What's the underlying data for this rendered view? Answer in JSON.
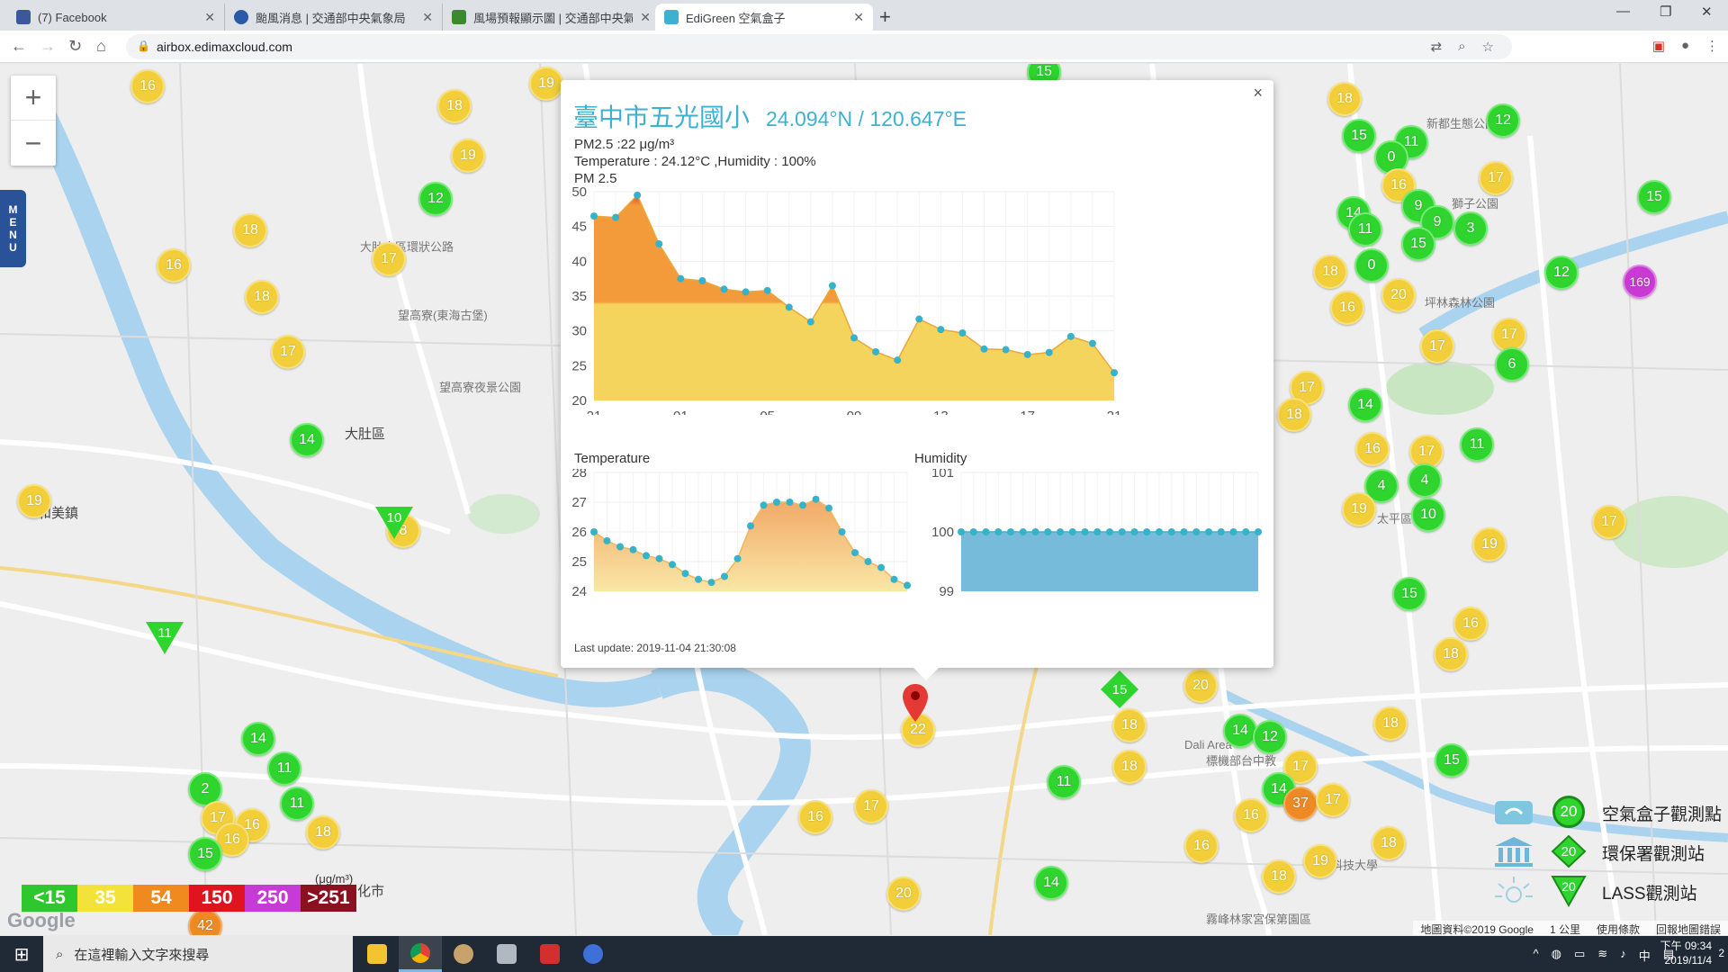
{
  "browser": {
    "tabs": [
      {
        "title": "(7) Facebook",
        "color": "#3b5998"
      },
      {
        "title": "颱風消息 | 交通部中央氣象局",
        "color": "#2a5aa8"
      },
      {
        "title": "風場預報顯示圖 | 交通部中央氣象局",
        "color": "#3c8a2e"
      },
      {
        "title": "EdiGreen 空氣盒子",
        "color": "#3eb1d0"
      }
    ],
    "url": "airbox.edimaxcloud.com"
  },
  "map": {
    "menu_label": "MENU",
    "labels": {
      "dadu": "大肚區",
      "hemei": "和美鎮",
      "wangshan": "望高寮(東海古堡)",
      "wangshan_park": "望高寮夜景公園",
      "dadu_road": "大肚山區環狀公路",
      "xinduk": "新都生態公園",
      "shizi": "獅子公園",
      "pinglin": "坪林森林公園",
      "taiping": "太平區",
      "dali": "Dali Area",
      "dali_zh": "大里區",
      "wufeng": "霧峰林家宮保第園區",
      "changhua": "彰化市",
      "dalisci": "大里科技大學",
      "fit_park": "標機部台中教"
    },
    "markers": [
      {
        "v": "16",
        "c": "y",
        "x": 164,
        "y": 96
      },
      {
        "v": "18",
        "c": "y",
        "x": 505,
        "y": 118
      },
      {
        "v": "19",
        "c": "y",
        "x": 520,
        "y": 173
      },
      {
        "v": "12",
        "c": "g",
        "x": 484,
        "y": 221
      },
      {
        "v": "18",
        "c": "y",
        "x": 278,
        "y": 256
      },
      {
        "v": "16",
        "c": "y",
        "x": 193,
        "y": 295
      },
      {
        "v": "17",
        "c": "y",
        "x": 432,
        "y": 288
      },
      {
        "v": "18",
        "c": "y",
        "x": 291,
        "y": 330
      },
      {
        "v": "17",
        "c": "y",
        "x": 320,
        "y": 391
      },
      {
        "v": "14",
        "c": "g",
        "x": 341,
        "y": 489
      },
      {
        "v": "19",
        "c": "y",
        "x": 38,
        "y": 557
      },
      {
        "v": "19",
        "c": "y",
        "x": 607,
        "y": 93
      },
      {
        "v": "15",
        "c": "g",
        "x": 1160,
        "y": 80
      },
      {
        "v": "18",
        "c": "y",
        "x": 1494,
        "y": 110
      },
      {
        "v": "15",
        "c": "g",
        "x": 1510,
        "y": 151
      },
      {
        "v": "11",
        "c": "g",
        "x": 1568,
        "y": 158
      },
      {
        "v": "0",
        "c": "g",
        "x": 1546,
        "y": 175
      },
      {
        "v": "12",
        "c": "g",
        "x": 1670,
        "y": 134
      },
      {
        "v": "16",
        "c": "y",
        "x": 1554,
        "y": 206
      },
      {
        "v": "17",
        "c": "y",
        "x": 1662,
        "y": 198
      },
      {
        "v": "15",
        "c": "g",
        "x": 1838,
        "y": 219
      },
      {
        "v": "14",
        "c": "g",
        "x": 1504,
        "y": 237
      },
      {
        "v": "11",
        "c": "g",
        "x": 1517,
        "y": 255
      },
      {
        "v": "9",
        "c": "g",
        "x": 1576,
        "y": 229
      },
      {
        "v": "9",
        "c": "g",
        "x": 1597,
        "y": 247
      },
      {
        "v": "15",
        "c": "g",
        "x": 1576,
        "y": 271
      },
      {
        "v": "3",
        "c": "g",
        "x": 1634,
        "y": 254
      },
      {
        "v": "0",
        "c": "g",
        "x": 1524,
        "y": 295
      },
      {
        "v": "18",
        "c": "y",
        "x": 1478,
        "y": 302
      },
      {
        "v": "20",
        "c": "y",
        "x": 1554,
        "y": 328
      },
      {
        "v": "16",
        "c": "y",
        "x": 1497,
        "y": 342
      },
      {
        "v": "12",
        "c": "g",
        "x": 1735,
        "y": 303
      },
      {
        "v": "169",
        "c": "p",
        "x": 1822,
        "y": 313
      },
      {
        "v": "17",
        "c": "y",
        "x": 1677,
        "y": 372
      },
      {
        "v": "6",
        "c": "g",
        "x": 1680,
        "y": 405
      },
      {
        "v": "17",
        "c": "y",
        "x": 1597,
        "y": 385
      },
      {
        "v": "17",
        "c": "y",
        "x": 1452,
        "y": 431
      },
      {
        "v": "18",
        "c": "y",
        "x": 1438,
        "y": 461
      },
      {
        "v": "14",
        "c": "g",
        "x": 1517,
        "y": 450
      },
      {
        "v": "11",
        "c": "g",
        "x": 1641,
        "y": 494
      },
      {
        "v": "16",
        "c": "y",
        "x": 1525,
        "y": 499
      },
      {
        "v": "17",
        "c": "y",
        "x": 1585,
        "y": 502
      },
      {
        "v": "4",
        "c": "g",
        "x": 1535,
        "y": 540
      },
      {
        "v": "4",
        "c": "g",
        "x": 1583,
        "y": 534
      },
      {
        "v": "19",
        "c": "y",
        "x": 1510,
        "y": 566
      },
      {
        "v": "10",
        "c": "g",
        "x": 1587,
        "y": 572
      },
      {
        "v": "17",
        "c": "y",
        "x": 1788,
        "y": 580
      },
      {
        "v": "19",
        "c": "y",
        "x": 1655,
        "y": 605
      },
      {
        "v": "15",
        "c": "g",
        "x": 1566,
        "y": 660
      },
      {
        "v": "16",
        "c": "y",
        "x": 1634,
        "y": 693
      },
      {
        "v": "18",
        "c": "y",
        "x": 1612,
        "y": 727
      },
      {
        "v": "18",
        "c": "y",
        "x": 1545,
        "y": 804
      },
      {
        "v": "15",
        "c": "g",
        "x": 1613,
        "y": 845
      },
      {
        "v": "20",
        "c": "y",
        "x": 1334,
        "y": 762
      },
      {
        "v": "18",
        "c": "y",
        "x": 1255,
        "y": 806
      },
      {
        "v": "14",
        "c": "g",
        "x": 1378,
        "y": 812
      },
      {
        "v": "12",
        "c": "g",
        "x": 1411,
        "y": 819
      },
      {
        "v": "17",
        "c": "y",
        "x": 1445,
        "y": 852
      },
      {
        "v": "18",
        "c": "y",
        "x": 1255,
        "y": 852
      },
      {
        "v": "14",
        "c": "g",
        "x": 1421,
        "y": 877
      },
      {
        "v": "37",
        "c": "o",
        "x": 1445,
        "y": 893
      },
      {
        "v": "17",
        "c": "y",
        "x": 1481,
        "y": 889
      },
      {
        "v": "16",
        "c": "y",
        "x": 1390,
        "y": 906
      },
      {
        "v": "11",
        "c": "g",
        "x": 1182,
        "y": 869
      },
      {
        "v": "18",
        "c": "y",
        "x": 1543,
        "y": 937
      },
      {
        "v": "16",
        "c": "y",
        "x": 1335,
        "y": 940
      },
      {
        "v": "19",
        "c": "y",
        "x": 1467,
        "y": 957
      },
      {
        "v": "18",
        "c": "y",
        "x": 1421,
        "y": 974
      },
      {
        "v": "14",
        "c": "g",
        "x": 1168,
        "y": 981
      },
      {
        "v": "17",
        "c": "y",
        "x": 968,
        "y": 896
      },
      {
        "v": "16",
        "c": "y",
        "x": 906,
        "y": 908
      },
      {
        "v": "20",
        "c": "y",
        "x": 1004,
        "y": 993
      },
      {
        "v": "22",
        "c": "y",
        "x": 1020,
        "y": 811
      },
      {
        "v": "14",
        "c": "g",
        "x": 287,
        "y": 821
      },
      {
        "v": "11",
        "c": "g",
        "x": 316,
        "y": 854
      },
      {
        "v": "2",
        "c": "g",
        "x": 228,
        "y": 877
      },
      {
        "v": "11",
        "c": "g",
        "x": 330,
        "y": 893
      },
      {
        "v": "17",
        "c": "y",
        "x": 242,
        "y": 909
      },
      {
        "v": "16",
        "c": "y",
        "x": 280,
        "y": 917
      },
      {
        "v": "18",
        "c": "y",
        "x": 359,
        "y": 925
      },
      {
        "v": "16",
        "c": "y",
        "x": 258,
        "y": 933
      },
      {
        "v": "15",
        "c": "g",
        "x": 228,
        "y": 949
      },
      {
        "v": "8",
        "c": "y",
        "x": 448,
        "y": 590
      },
      {
        "v": "42",
        "c": "o",
        "x": 228,
        "y": 1029
      }
    ]
  },
  "popup": {
    "site": "臺中市五光國小",
    "coords": "24.094°N / 120.647°E",
    "pm25_line": "PM2.5 :22 μg/m³",
    "temp_line": "Temperature : 24.12°C ,Humidity : 100%",
    "chart_title": "PM 2.5",
    "temp_title": "Temperature",
    "hum_title": "Humidity",
    "last_update": "Last update: 2019-11-04 21:30:08",
    "close": "×"
  },
  "chart_data": [
    {
      "type": "area",
      "title": "PM 2.5",
      "x_ticks": [
        "21",
        "01",
        "05",
        "09",
        "13",
        "17",
        "21"
      ],
      "ylim": [
        20,
        50
      ],
      "y_ticks": [
        20,
        25,
        30,
        35,
        40,
        45,
        50
      ],
      "values": [
        46.5,
        46.3,
        49.5,
        42.5,
        37.5,
        37.2,
        36.0,
        35.6,
        35.8,
        33.4,
        31.3,
        36.5,
        29.0,
        27.0,
        25.8,
        31.7,
        30.2,
        29.7,
        27.4,
        27.3,
        26.6,
        26.9,
        29.2,
        28.2,
        24.0
      ],
      "color_low": "#f5d45e",
      "color_mid": "#f39a3a"
    },
    {
      "type": "area",
      "title": "Temperature",
      "ylim": [
        24,
        28
      ],
      "y_ticks": [
        24,
        25,
        26,
        27,
        28
      ],
      "values": [
        26.0,
        25.7,
        25.5,
        25.4,
        25.2,
        25.1,
        24.9,
        24.6,
        24.4,
        24.3,
        24.5,
        25.1,
        26.2,
        26.9,
        27.0,
        27.0,
        26.9,
        27.1,
        26.8,
        26.0,
        25.3,
        25.0,
        24.8,
        24.4,
        24.2
      ],
      "color": "#f5c87e"
    },
    {
      "type": "area",
      "title": "Humidity",
      "ylim": [
        99,
        101
      ],
      "y_ticks": [
        99,
        100,
        101
      ],
      "values": [
        100,
        100,
        100,
        100,
        100,
        100,
        100,
        100,
        100,
        100,
        100,
        100,
        100,
        100,
        100,
        100,
        100,
        100,
        100,
        100,
        100,
        100,
        100,
        100,
        100
      ],
      "color": "#6fb7d8"
    }
  ],
  "aqi_legend": {
    "items": [
      {
        "label": "<15",
        "color": "#2ec82e"
      },
      {
        "label": "35",
        "color": "#f2e23a"
      },
      {
        "label": "54",
        "color": "#f08a1e"
      },
      {
        "label": "150",
        "color": "#e0141e"
      },
      {
        "label": "250",
        "color": "#c63bd6"
      },
      {
        "label": ">251",
        "color": "#8b1020"
      }
    ],
    "unit": "(μg/m³)"
  },
  "station_legend": {
    "airbox": {
      "label": "空氣盒子觀測點",
      "value": "20"
    },
    "epa": {
      "label": "環保署觀測站",
      "value": "20"
    },
    "lass": {
      "label": "LASS觀測站",
      "value": "20"
    }
  },
  "map_footer": {
    "data": "地圖資料©2019 Google",
    "scale": "1 公里",
    "terms": "使用條款",
    "report": "回報地圖錯誤",
    "logo": "Google"
  },
  "taskbar": {
    "search_placeholder": "在這裡輸入文字來搜尋",
    "time": "下午 09:34",
    "date": "2019/11/4",
    "ime": "中",
    "notif": "2"
  }
}
